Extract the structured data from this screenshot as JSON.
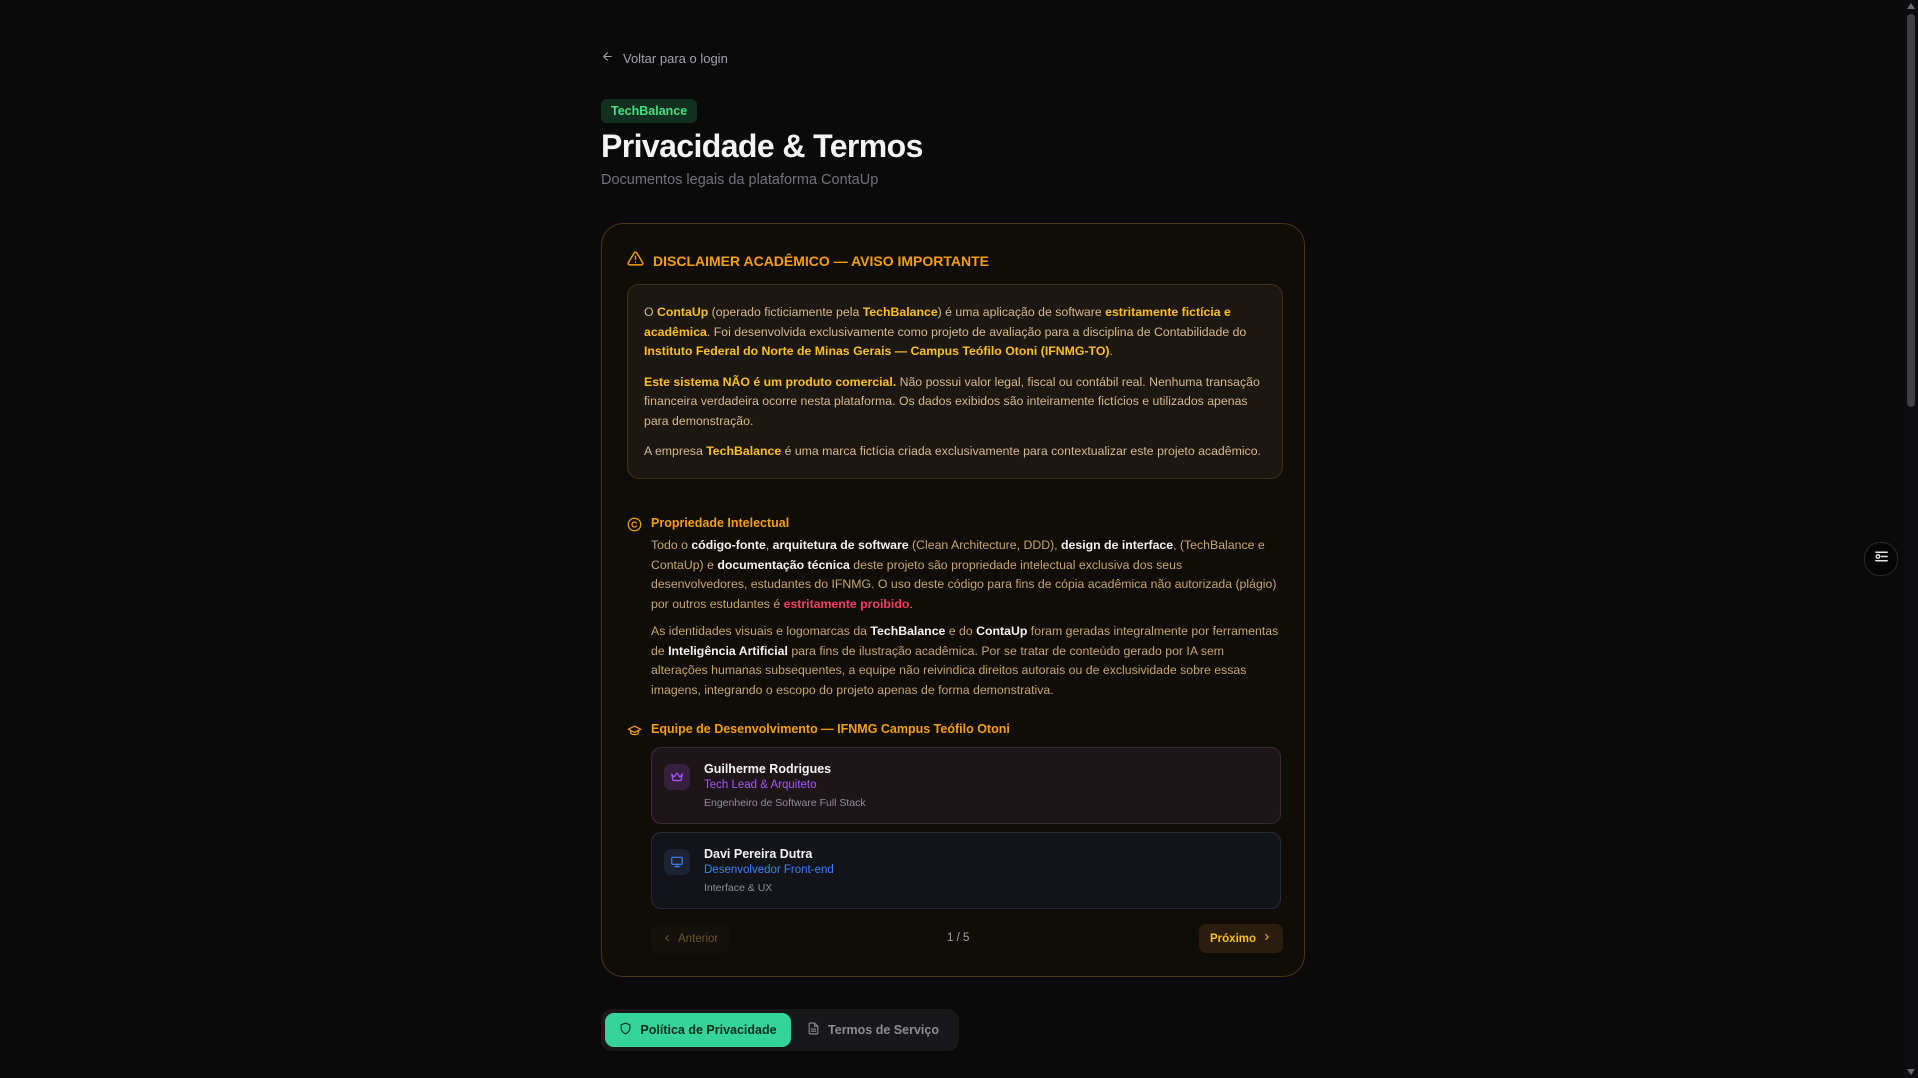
{
  "back_link": "Voltar para o login",
  "brand_badge": "TechBalance",
  "page_title": "Privacidade & Termos",
  "page_subtitle": "Documentos legais da plataforma ContaUp",
  "disclaimer": {
    "title": "DISCLAIMER ACADÊMICO — AVISO IMPORTANTE",
    "p1": {
      "a": "O ",
      "b": "ContaUp",
      "c": " (operado ficticiamente pela ",
      "d": "TechBalance",
      "e": ") é uma aplicação de software ",
      "f": "estritamente fictícia e acadêmica",
      "g": ". Foi desenvolvida exclusivamente como projeto de avaliação para a disciplina de Contabilidade do ",
      "h": "Instituto Federal do Norte de Minas Gerais — Campus Teófilo Otoni (IFNMG-TO)",
      "i": "."
    },
    "p2": {
      "a": "Este sistema NÃO é um produto comercial.",
      "b": " Não possui valor legal, fiscal ou contábil real. Nenhuma transação financeira verdadeira ocorre nesta plataforma. Os dados exibidos são inteiramente fictícios e utilizados apenas para demonstração."
    },
    "p3": {
      "a": "A empresa ",
      "b": "TechBalance",
      "c": " é uma marca fictícia criada exclusivamente para contextualizar este projeto acadêmico."
    }
  },
  "ip": {
    "title": "Propriedade Intelectual",
    "p1": {
      "a": "Todo o ",
      "b": "código-fonte",
      "c": ", ",
      "d": "arquitetura de software",
      "e": " (Clean Architecture, DDD), ",
      "f": "design de interface",
      "g": ", (TechBalance e ContaUp) e ",
      "h": "documentação técnica",
      "i": " deste projeto são propriedade intelectual exclusiva dos seus desenvolvedores, estudantes do IFNMG. O uso deste código para fins de cópia acadêmica não autorizada (plágio) por outros estudantes é ",
      "j": "estritamente proibido",
      "k": "."
    },
    "p2": {
      "a": "As identidades visuais e logomarcas da ",
      "b": "TechBalance",
      "c": " e do ",
      "d": "ContaUp",
      "e": " foram geradas integralmente por ferramentas de ",
      "f": "Inteligência Artificial",
      "g": " para fins de ilustração acadêmica. Por se tratar de conteúdo gerado por IA sem alterações humanas subsequentes, a equipe não reivindica direitos autorais ou de exclusividade sobre essas imagens, integrando o escopo do projeto apenas de forma demonstrativa."
    }
  },
  "team": {
    "title": "Equipe de Desenvolvimento — IFNMG Campus Teófilo Otoni",
    "members": [
      {
        "name": "Guilherme Rodrigues",
        "role": "Tech Lead & Arquiteto",
        "desc": "Engenheiro de Software Full Stack",
        "icon": "crown-icon"
      },
      {
        "name": "Davi Pereira Dutra",
        "role": "Desenvolvedor Front-end",
        "desc": "Interface & UX",
        "icon": "monitor-icon"
      }
    ],
    "pager": {
      "prev": "Anterior",
      "count": "1 / 5",
      "next": "Próximo"
    }
  },
  "tabs": {
    "privacy": "Política de Privacidade",
    "terms": "Termos de Serviço",
    "active": "privacy"
  },
  "colors": {
    "accent_amber": "#f59e0b",
    "accent_green": "#34d399",
    "purple": "#a855f7",
    "blue": "#3b82f6",
    "danger": "#f43f5e"
  }
}
